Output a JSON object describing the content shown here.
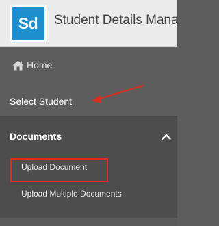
{
  "header": {
    "logo_text": "Sd",
    "app_title": "Student Details Mana"
  },
  "nav": {
    "home_label": "Home",
    "home_icon": "home-icon",
    "select_student_label": "Select Student"
  },
  "documents": {
    "title": "Documents",
    "chevron_icon": "chevron-up-icon",
    "items": [
      {
        "label": "Upload Document"
      },
      {
        "label": "Upload Multiple Documents"
      }
    ]
  },
  "annotations": {
    "arrow_color": "#e02b1c",
    "highlight_color": "#e02b1c"
  },
  "colors": {
    "sidebar_bg": "#5d5d5d",
    "section_bg": "#4d4d4d",
    "brand_blue": "#1e8fcc",
    "header_bg": "#ebebeb"
  }
}
